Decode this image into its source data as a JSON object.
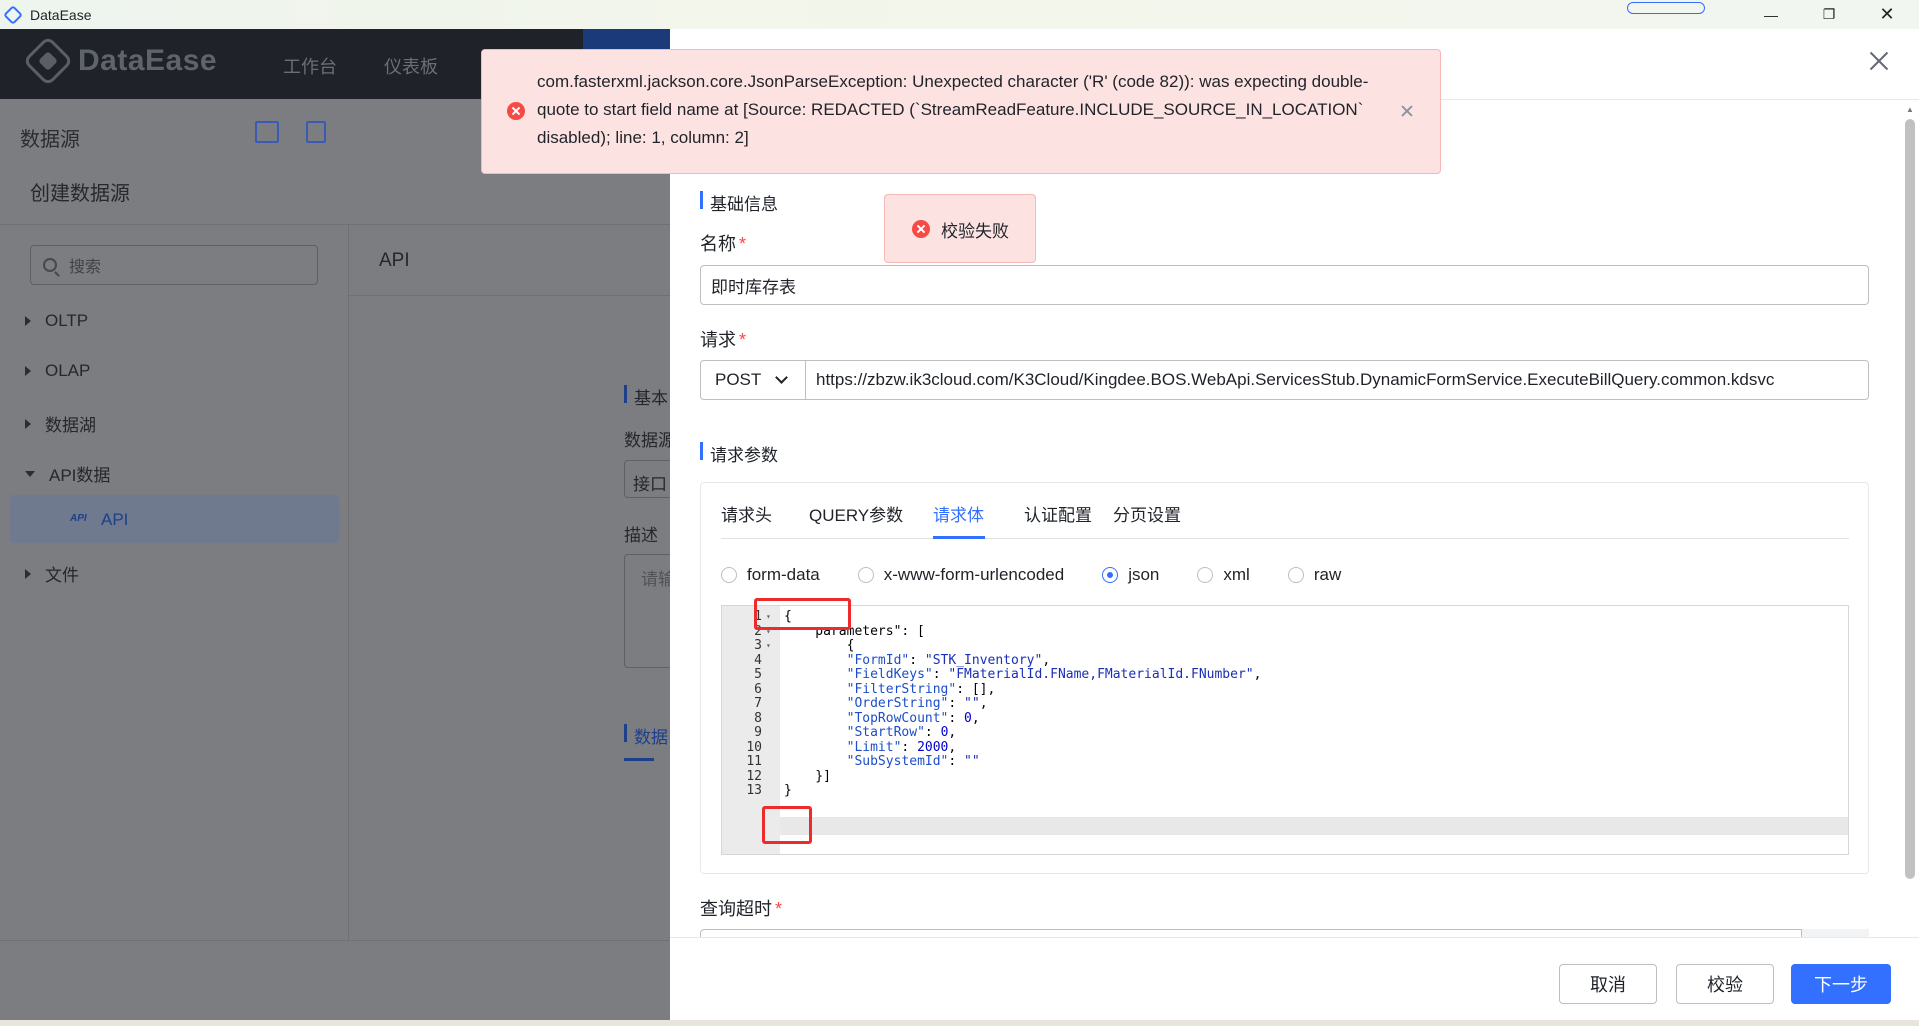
{
  "window": {
    "title": "DataEase",
    "minimize_icon": "minimize-icon",
    "maximize_icon": "restore-icon",
    "close_icon": "close-icon"
  },
  "header": {
    "logo_text": "DataEase",
    "nav": [
      "工作台",
      "仪表板"
    ]
  },
  "datasource_bar": {
    "title": "数据源"
  },
  "create_panel": {
    "title": "创建数据源",
    "search_placeholder": "搜索",
    "tree": [
      {
        "label": "OLTP",
        "expanded": false
      },
      {
        "label": "OLAP",
        "expanded": false
      },
      {
        "label": "数据湖",
        "expanded": false
      },
      {
        "label": "API数据",
        "expanded": true
      },
      {
        "label": "文件",
        "expanded": false
      }
    ],
    "selected_child": {
      "tag": "API",
      "label": "API"
    },
    "content_title": "API",
    "bg_labels": {
      "basic": "基本",
      "datasource": "数据源",
      "interface": "接口",
      "description": "描述",
      "desc_placeholder": "请输",
      "data": "数据"
    }
  },
  "drawer": {
    "section_basic": "基础信息",
    "name_label": "名称",
    "name_value": "即时库存表",
    "request_label": "请求",
    "method": "POST",
    "url": "https://zbzw.ik3cloud.com/K3Cloud/Kingdee.BOS.WebApi.ServicesStub.DynamicFormService.ExecuteBillQuery.common.kdsvc",
    "section_params": "请求参数",
    "tabs": [
      "请求头",
      "QUERY参数",
      "请求体",
      "认证配置",
      "分页设置"
    ],
    "active_tab": "请求体",
    "body_types": [
      "form-data",
      "x-www-form-urlencoded",
      "json",
      "xml",
      "raw"
    ],
    "selected_body_type": "json",
    "code_lines": [
      "{",
      "    parameters\": [",
      "        {",
      "        \"FormId\": \"STK_Inventory\",",
      "        \"FieldKeys\": \"FMaterialId.FName,FMaterialId.FNumber\",",
      "        \"FilterString\": [],",
      "        \"OrderString\": \"\",",
      "        \"TopRowCount\": 0,",
      "        \"StartRow\": 0,",
      "        \"Limit\": 2000,",
      "        \"SubSystemId\": \"\"",
      "    }]",
      "}"
    ],
    "timeout_label": "查询超时",
    "buttons": {
      "cancel": "取消",
      "validate": "校验",
      "next": "下一步"
    }
  },
  "toasts": {
    "error_message": "com.fasterxml.jackson.core.JsonParseException: Unexpected character ('R' (code 82)): was expecting double-quote to start field name at [Source: REDACTED (`StreamReadFeature.INCLUDE_SOURCE_IN_LOCATION` disabled); line: 1, column: 2]",
    "validate_failed": "校验失败"
  },
  "colors": {
    "primary": "#3370ff",
    "error": "#f54a45",
    "header_bg": "#1f2329"
  }
}
